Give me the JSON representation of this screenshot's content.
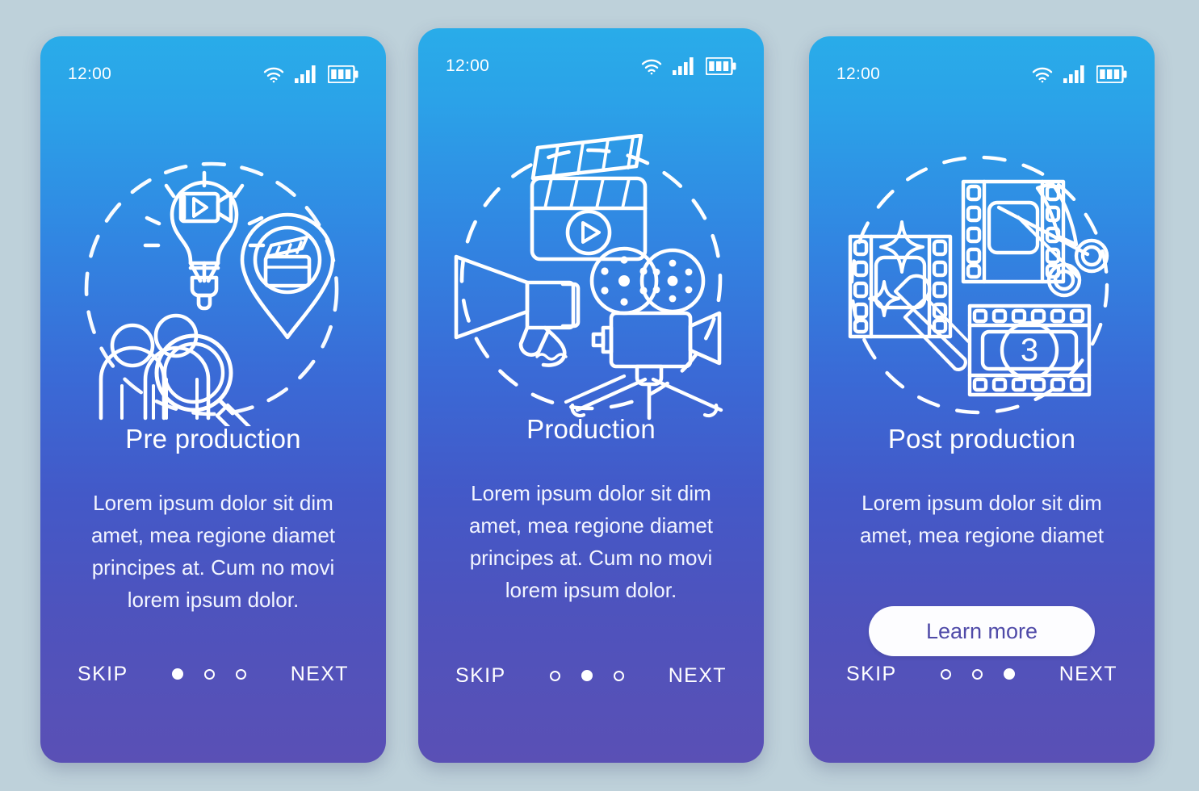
{
  "page": {
    "background_color": "#bed1da",
    "card_gradient_top": "#29ace9",
    "card_gradient_bottom": "#5a50b5"
  },
  "screens": [
    {
      "id": "pre-production",
      "status": {
        "time": "12:00",
        "wifi_icon": "wifi-icon",
        "signal_icon": "cellular-signal-icon",
        "battery_icon": "battery-icon"
      },
      "illustration": "pre-production-illustration",
      "title": "Pre production",
      "description": "Lorem ipsum dolor sit dim amet, mea regione diamet principes at. Cum no movi lorem ipsum dolor.",
      "cta": null,
      "footer": {
        "skip_label": "SKIP",
        "next_label": "NEXT",
        "dots": 3,
        "active_dot": 1
      }
    },
    {
      "id": "production",
      "status": {
        "time": "12:00",
        "wifi_icon": "wifi-icon",
        "signal_icon": "cellular-signal-icon",
        "battery_icon": "battery-icon"
      },
      "illustration": "production-illustration",
      "title": "Production",
      "description": "Lorem ipsum dolor sit dim amet, mea regione diamet principes at. Cum no movi lorem ipsum dolor.",
      "cta": null,
      "footer": {
        "skip_label": "SKIP",
        "next_label": "NEXT",
        "dots": 3,
        "active_dot": 2
      }
    },
    {
      "id": "post-production",
      "status": {
        "time": "12:00",
        "wifi_icon": "wifi-icon",
        "signal_icon": "cellular-signal-icon",
        "battery_icon": "battery-icon"
      },
      "illustration": "post-production-illustration",
      "title": "Post production",
      "description": "Lorem ipsum dolor sit dim amet, mea regione diamet",
      "cta": {
        "label": "Learn more",
        "text_color": "#4f4aa8",
        "background_color": "#fdfdff"
      },
      "footer": {
        "skip_label": "SKIP",
        "next_label": "NEXT",
        "dots": 3,
        "active_dot": 3
      }
    }
  ],
  "illustration_labels": {
    "film_counter_number": "3"
  }
}
